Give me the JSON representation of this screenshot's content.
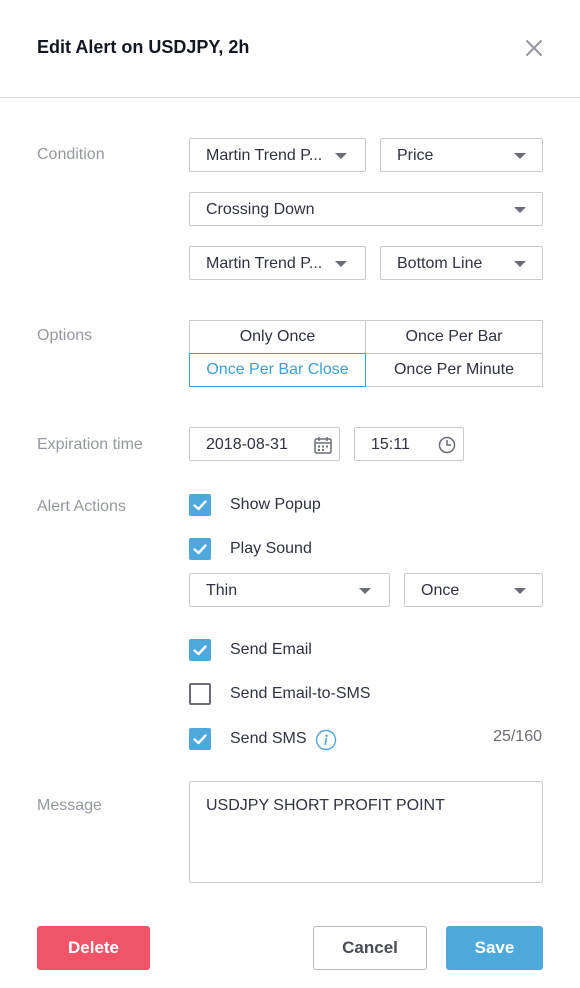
{
  "dialog": {
    "title": "Edit Alert on USDJPY, 2h"
  },
  "condition": {
    "label": "Condition",
    "indicator_1": "Martin Trend P...",
    "plot_1": "Price",
    "operator": "Crossing Down",
    "indicator_2": "Martin Trend P...",
    "plot_2": "Bottom Line"
  },
  "options": {
    "label": "Options",
    "items": [
      "Only Once",
      "Once Per Bar",
      "Once Per Bar Close",
      "Once Per Minute"
    ],
    "selected": "Once Per Bar Close"
  },
  "expiration": {
    "label": "Expiration time",
    "date": "2018-08-31",
    "time": "15:11"
  },
  "alert_actions": {
    "label": "Alert Actions",
    "show_popup": {
      "label": "Show Popup",
      "checked": true
    },
    "play_sound": {
      "label": "Play Sound",
      "checked": true
    },
    "sound_name": "Thin",
    "sound_repeat": "Once",
    "send_email": {
      "label": "Send Email",
      "checked": true
    },
    "send_email_sms": {
      "label": "Send Email-to-SMS",
      "checked": false
    },
    "send_sms": {
      "label": "Send SMS",
      "checked": true
    },
    "sms_counter": "25/160"
  },
  "message": {
    "label": "Message",
    "value": "USDJPY SHORT PROFIT POINT"
  },
  "buttons": {
    "delete": "Delete",
    "cancel": "Cancel",
    "save": "Save"
  },
  "colors": {
    "accent": "#4fa8dc",
    "danger": "#ef5468",
    "label_gray": "#9598a1"
  },
  "icons": {
    "close": "close-icon",
    "calendar": "calendar-icon",
    "clock": "clock-icon",
    "info": "info-icon",
    "checkmark": "checkmark-icon",
    "caret": "chevron-down-icon"
  }
}
